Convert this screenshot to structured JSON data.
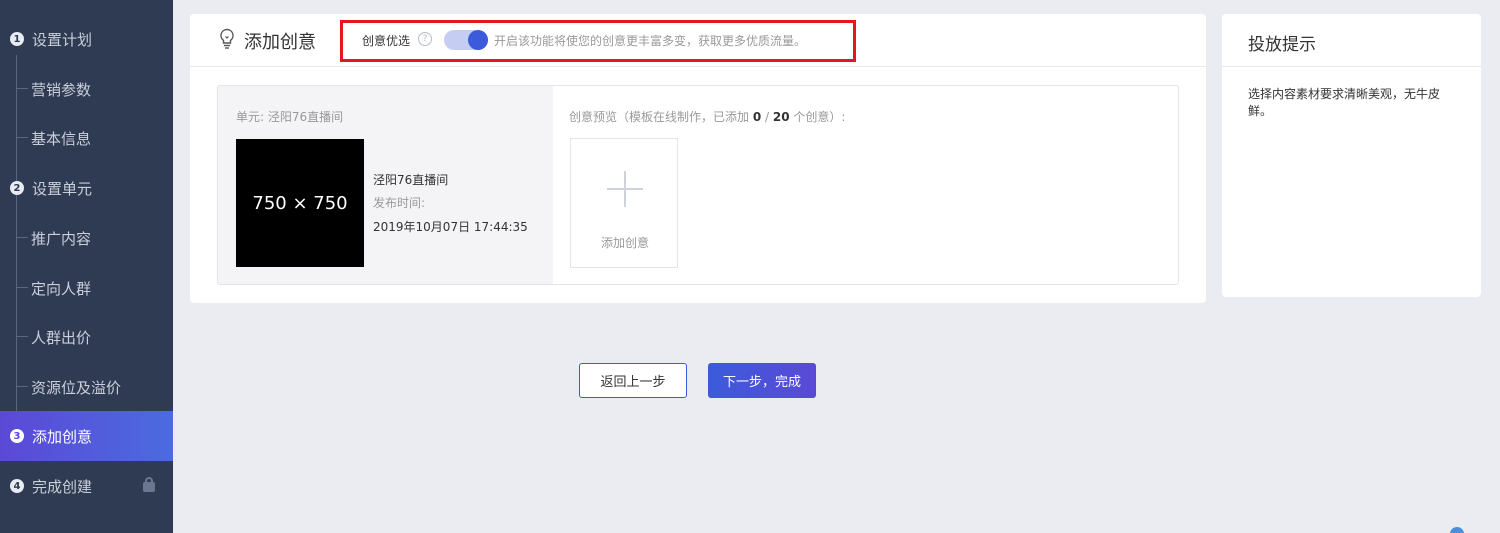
{
  "sidebar": {
    "items": [
      {
        "num": "1",
        "label": "设置计划"
      },
      {
        "label": "营销参数"
      },
      {
        "label": "基本信息"
      },
      {
        "num": "2",
        "label": "设置单元"
      },
      {
        "label": "推广内容"
      },
      {
        "label": "定向人群"
      },
      {
        "label": "人群出价"
      },
      {
        "label": "资源位及溢价"
      },
      {
        "num": "3",
        "label": "添加创意",
        "active": true
      },
      {
        "num": "4",
        "label": "完成创建",
        "locked": true
      }
    ]
  },
  "card": {
    "title": "添加创意",
    "option_label": "创意优选",
    "help_glyph": "?",
    "toggle_on": true,
    "toggle_desc": "开启该功能将使您的创意更丰富多变，获取更多优质流量。",
    "unit_name": "单元: 泾阳76直播间",
    "thumb_text": "750 × 750",
    "item_title": "泾阳76直播间",
    "time_label": "发布时间:",
    "time_value": "2019年10月07日 17:44:35",
    "preview_prefix": "创意预览（模板在线制作，已添加 ",
    "preview_added": "0",
    "preview_sep": " / ",
    "preview_total": "20",
    "preview_suffix": " 个创意）:",
    "add_label": "添加创意"
  },
  "tips": {
    "title": "投放提示",
    "text": "选择内容素材要求清晰美观，无牛皮鲜。"
  },
  "actions": {
    "back_label": "返回上一步",
    "next_label": "下一步，完成"
  },
  "colors": {
    "sidebar_bg": "#2f3b52",
    "accent": "#3b5bdb",
    "highlight": "#e8141f"
  }
}
